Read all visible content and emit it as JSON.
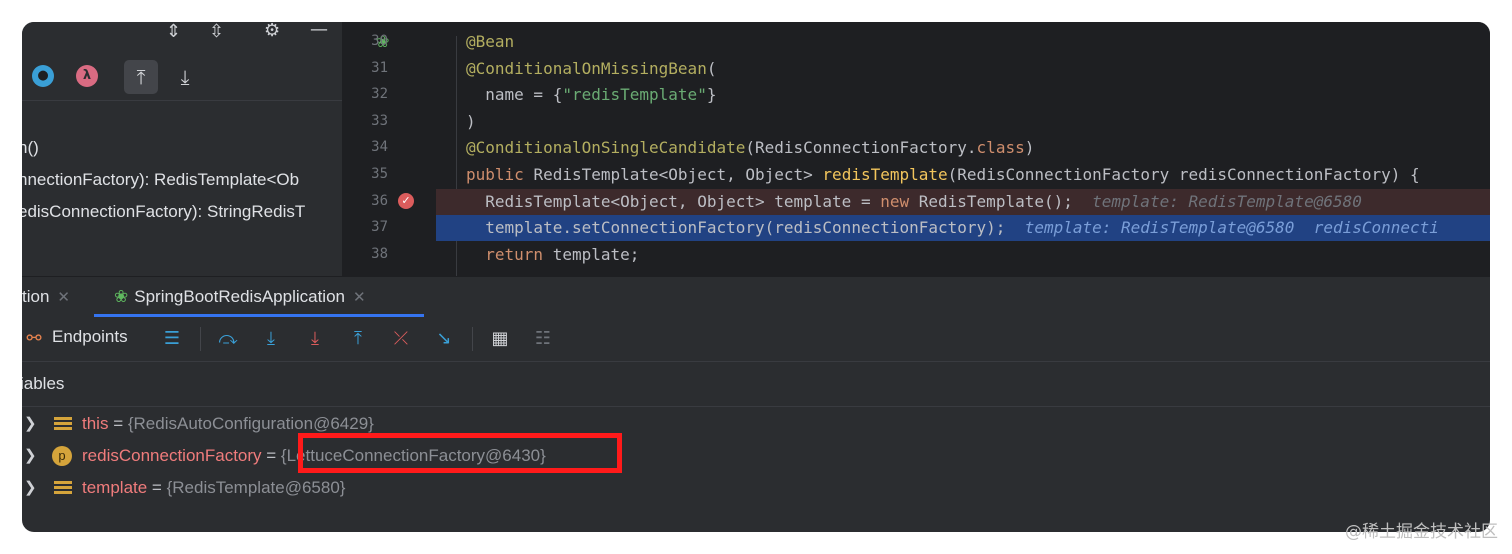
{
  "structure": {
    "items": [
      "n()",
      "nnectionFactory): RedisTemplate<Ob",
      "edisConnectionFactory): StringRedisT"
    ]
  },
  "editor": {
    "line_numbers": [
      "30",
      "31",
      "32",
      "33",
      "34",
      "35",
      "36",
      "37",
      "38"
    ],
    "lines": [
      {
        "segments": [
          {
            "t": "@Bean",
            "c": "ann"
          }
        ]
      },
      {
        "segments": [
          {
            "t": "@ConditionalOnMissingBean",
            "c": "ann"
          },
          {
            "t": "(",
            "c": "par"
          }
        ]
      },
      {
        "segments": [
          {
            "t": "  name = {",
            "c": "par"
          },
          {
            "t": "\"redisTemplate\"",
            "c": "str"
          },
          {
            "t": "}",
            "c": "par"
          }
        ]
      },
      {
        "segments": [
          {
            "t": ")",
            "c": "par"
          }
        ]
      },
      {
        "segments": [
          {
            "t": "@ConditionalOnSingleCandidate",
            "c": "ann"
          },
          {
            "t": "(RedisConnectionFactory.",
            "c": "par"
          },
          {
            "t": "class",
            "c": "kw"
          },
          {
            "t": ")",
            "c": "par"
          }
        ]
      },
      {
        "segments": [
          {
            "t": "public ",
            "c": "kw"
          },
          {
            "t": "RedisTemplate<Object, Object> ",
            "c": "par"
          },
          {
            "t": "redisTemplate",
            "c": "fn"
          },
          {
            "t": "(RedisConnectionFactory redisConnectionFactory) {",
            "c": "par"
          }
        ]
      },
      {
        "segments": [
          {
            "t": "  RedisTemplate<Object, Object> template = ",
            "c": "par"
          },
          {
            "t": "new ",
            "c": "kw"
          },
          {
            "t": "RedisTemplate();",
            "c": "par"
          },
          {
            "t": "  template: RedisTemplate@6580",
            "c": "hint"
          }
        ]
      },
      {
        "segments": [
          {
            "t": "  template.setConnectionFactory(redisConnectionFactory);",
            "c": "par"
          },
          {
            "t": "  template: RedisTemplate@6580  redisConnecti",
            "c": "hint-sel"
          }
        ]
      },
      {
        "segments": [
          {
            "t": "  ",
            "c": "par"
          },
          {
            "t": "return ",
            "c": "kw"
          },
          {
            "t": "template;",
            "c": "par"
          }
        ]
      }
    ]
  },
  "tabs": {
    "prev_label": "tion",
    "active_label": "SpringBootRedisApplication"
  },
  "toolbar": {
    "endpoints_label": "Endpoints"
  },
  "variables": {
    "title": "iables",
    "rows": [
      {
        "name": "this",
        "eq": " = ",
        "value": "{RedisAutoConfiguration@6429}",
        "icon": "field"
      },
      {
        "name": "redisConnectionFactory",
        "eq": " = ",
        "value": "{LettuceConnectionFactory@6430}",
        "icon": "param"
      },
      {
        "name": "template",
        "eq": " = ",
        "value": "{RedisTemplate@6580}",
        "icon": "field"
      }
    ]
  },
  "watermark": "@稀土掘金技术社区",
  "colors": {
    "accent": "#3574f0",
    "highlight": "#ff1a1a",
    "selection": "#214283"
  }
}
